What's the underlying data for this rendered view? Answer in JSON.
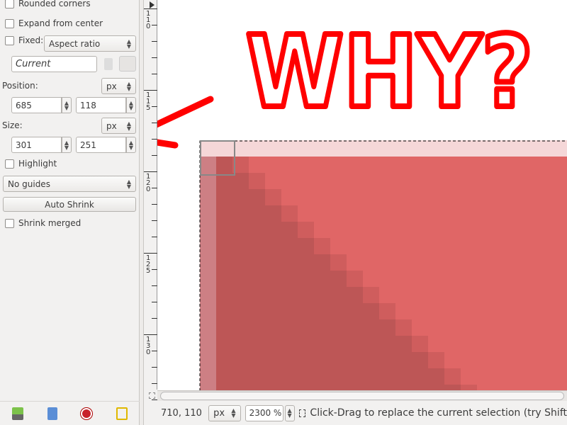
{
  "options": {
    "rounded_corners": "Rounded corners",
    "expand_from_center": "Expand from center",
    "fixed_label": "Fixed:",
    "fixed_mode": "Aspect ratio",
    "fixed_value": "Current",
    "position_label": "Position:",
    "position_unit": "px",
    "position_x": "685",
    "position_y": "118",
    "size_label": "Size:",
    "size_unit": "px",
    "size_w": "301",
    "size_h": "251",
    "highlight": "Highlight",
    "guides": "No guides",
    "auto_shrink": "Auto Shrink",
    "shrink_merged": "Shrink merged"
  },
  "ruler": {
    "labels": [
      "110",
      "115",
      "120",
      "125",
      "130"
    ]
  },
  "annotation": {
    "text": "WHY?",
    "color": "#ff0000"
  },
  "canvas_colors": {
    "light": "#e06666",
    "dark": "#bd5656",
    "top_strip": "#f5d7d8",
    "left_strip": "#cd7f84"
  },
  "status": {
    "coords": "710, 110",
    "unit": "px",
    "zoom": "2300 %",
    "message": "Click-Drag to replace the current selection (try Shift"
  },
  "bottom_icons": [
    "save-options-icon",
    "restore-options-icon",
    "delete-options-icon",
    "reset-options-icon"
  ]
}
